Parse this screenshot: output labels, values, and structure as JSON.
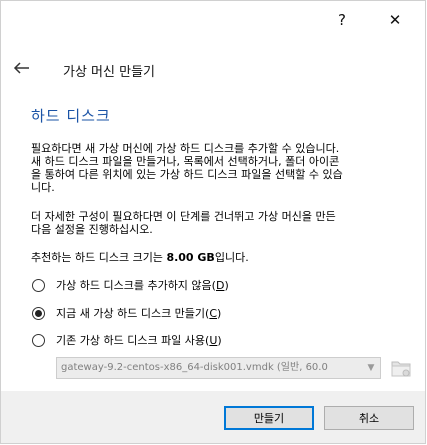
{
  "titlebar": {
    "help_label": "?",
    "close_label": "✕"
  },
  "header": {
    "title": "가상 머신 만들기"
  },
  "section": {
    "title": "하드 디스크"
  },
  "body": {
    "p1": [
      "필요하다면 새 가상 머신에 가상 하드 디스크를 추가할 수 있습니다.",
      "새 하드 디스크 파일을 만들거나, 목록에서 선택하거나, 폴더 아이콘",
      "을 통하여 다른 위치에 있는 가상 하드 디스크 파일을 선택할 수 있습",
      "니다."
    ],
    "p2": [
      "더 자세한 구성이 필요하다면 이 단계를 건너뛰고 가상 머신을 만든",
      "다음 설정을 진행하십시오."
    ],
    "size_prefix": "추천하는 하드 디스크 크기는 ",
    "size_value": "8.00 GB",
    "size_suffix": "입니다."
  },
  "options": [
    {
      "label": "가상 하드 디스크를 추가하지 않음(",
      "key": "D",
      "end": ")",
      "selected": false
    },
    {
      "label": "지금 새 가상 하드 디스크 만들기(",
      "key": "C",
      "end": ")",
      "selected": true
    },
    {
      "label": "기존 가상 하드 디스크 파일 사용(",
      "key": "U",
      "end": ")",
      "selected": false
    }
  ],
  "existing_disk": {
    "value": "gateway-9.2-centos-x86_64-disk001.vmdk (일반, 60.0"
  },
  "buttons": {
    "create": "만들기",
    "cancel": "취소"
  }
}
